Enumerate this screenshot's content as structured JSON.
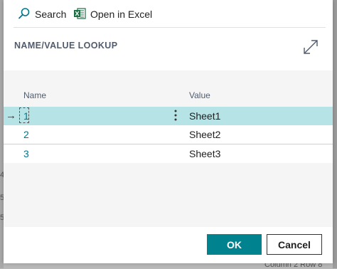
{
  "toolbar": {
    "search_label": "Search",
    "excel_label": "Open in Excel"
  },
  "dialog": {
    "title": "NAME/VALUE LOOKUP"
  },
  "list": {
    "columns": {
      "name": "Name",
      "value": "Value"
    },
    "rows": [
      {
        "name": "1",
        "value": "Sheet1",
        "selected": true
      },
      {
        "name": "2",
        "value": "Sheet2",
        "selected": false
      },
      {
        "name": "3",
        "value": "Sheet3",
        "selected": false
      }
    ]
  },
  "footer": {
    "ok_label": "OK",
    "cancel_label": "Cancel"
  },
  "background": {
    "bottom_text": "Column 2 Row 8"
  },
  "colors": {
    "accent": "#00838f",
    "selected_row": "#b6e3e6",
    "link_text": "#00778a",
    "excel_green": "#1d7044"
  }
}
